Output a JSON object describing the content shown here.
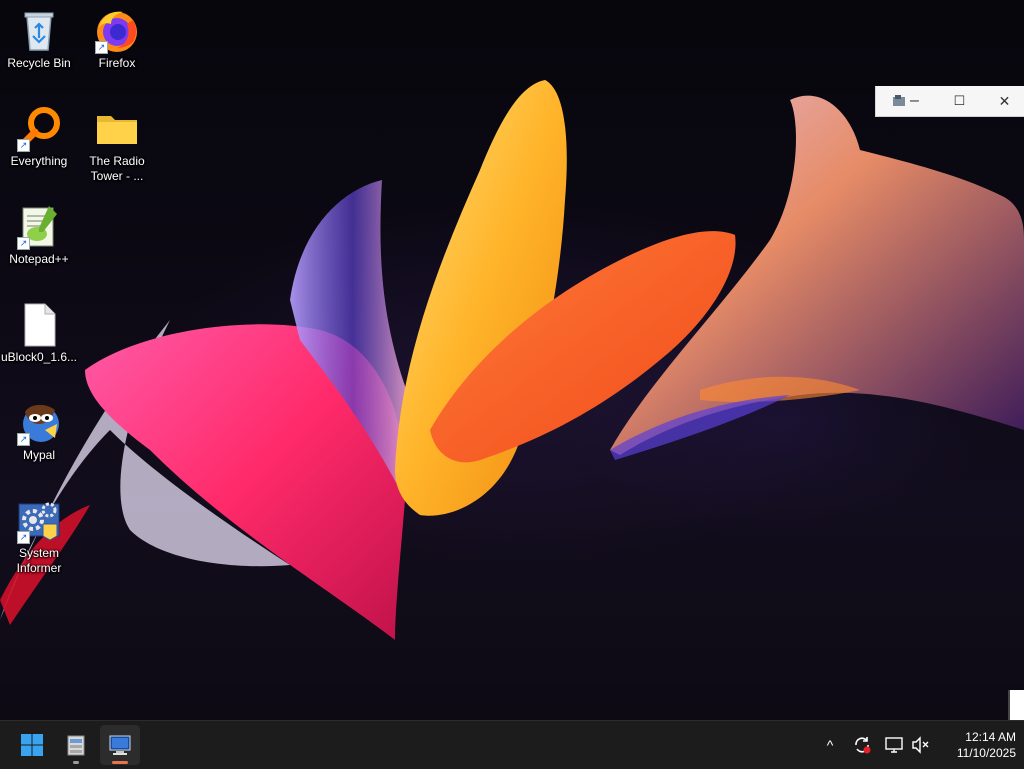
{
  "desktop": {
    "icons": [
      {
        "label": "Recycle Bin",
        "icon": "recycle-bin-icon"
      },
      {
        "label": "Firefox",
        "icon": "firefox-icon"
      },
      {
        "label": "Everything",
        "icon": "everything-search-icon"
      },
      {
        "label": "The Radio Tower - ...",
        "icon": "folder-icon"
      },
      {
        "label": "Notepad++",
        "icon": "notepad-plus-plus-icon"
      },
      {
        "label": "uBlock0_1.6...",
        "icon": "blank-file-icon"
      },
      {
        "label": "Mypal",
        "icon": "mypal-icon"
      },
      {
        "label": "System Informer",
        "icon": "system-informer-icon"
      }
    ]
  },
  "window_controls": {
    "minimize": "–",
    "maximize": "☐",
    "close": "✕"
  },
  "taskbar": {
    "start": "start-icon",
    "pinned": [
      {
        "icon": "archive-app-icon"
      },
      {
        "icon": "remote-desktop-icon"
      }
    ],
    "tray": {
      "overflow": "^",
      "icons": [
        "sync-alert-icon",
        "network-icon",
        "volume-muted-icon"
      ]
    },
    "clock": {
      "time": "12:14 AM",
      "date": "11/10/2025"
    }
  },
  "colors": {
    "taskbar_bg": "#1c1c1c",
    "accent_blue": "#3aa3f0",
    "indicator_orange": "#e8734a"
  }
}
